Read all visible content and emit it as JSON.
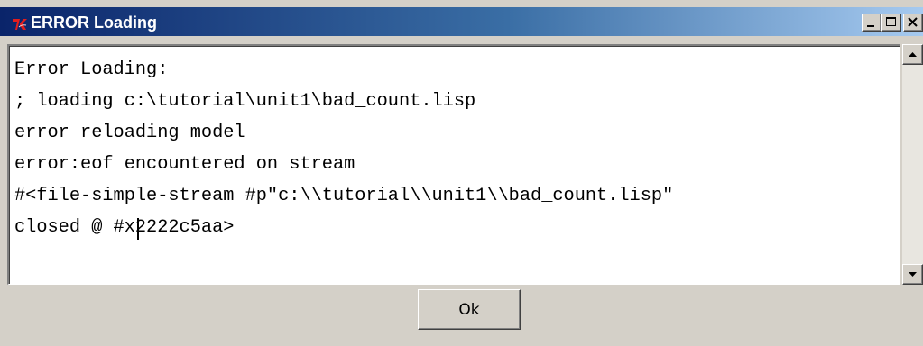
{
  "window": {
    "title": "ERROR Loading",
    "icon": "tk-feather-icon"
  },
  "caption_buttons": {
    "minimize": "minimize-icon",
    "maximize": "maximize-icon",
    "close": "close-icon"
  },
  "message": {
    "lines": [
      "Error Loading:",
      "; loading c:\\tutorial\\unit1\\bad_count.lisp",
      "error reloading model",
      "error:eof encountered on stream",
      "#<file-simple-stream #p\"c:\\\\tutorial\\\\unit1\\\\bad_count.lisp\"",
      "closed @ #x2222c5aa>"
    ]
  },
  "scrollbar": {
    "up": "up-arrow-icon",
    "down": "down-arrow-icon"
  },
  "buttons": {
    "ok_label": "Ok"
  },
  "colors": {
    "titlebar_start": "#0a246a",
    "titlebar_end": "#a6caf0",
    "dialog_face": "#d4d0c8"
  }
}
